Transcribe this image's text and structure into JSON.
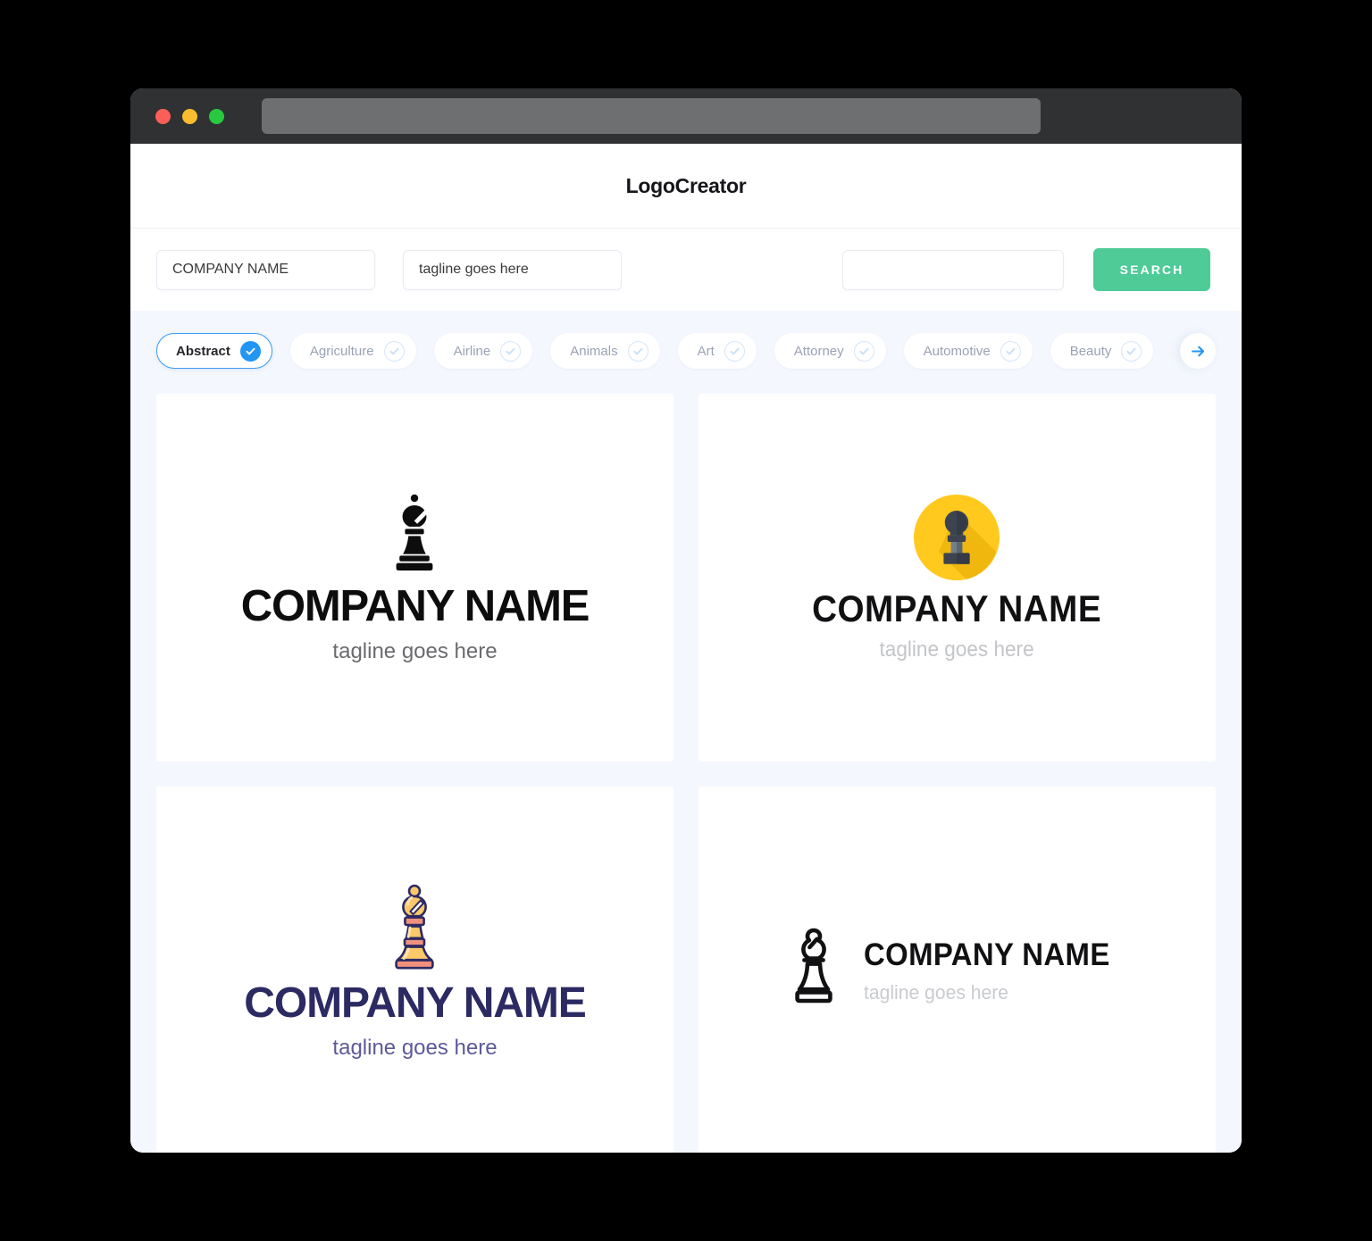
{
  "window": {
    "traffic_lights": [
      {
        "name": "close",
        "color": "#fb5f57"
      },
      {
        "name": "minimize",
        "color": "#fbbd2e"
      },
      {
        "name": "zoom",
        "color": "#28c840"
      }
    ],
    "url_value": "",
    "url_placeholder": ""
  },
  "header": {
    "title": "LogoCreator"
  },
  "search": {
    "company_value": "COMPANY NAME",
    "company_placeholder": "COMPANY NAME",
    "tagline_value": "tagline goes here",
    "tagline_placeholder": "tagline goes here",
    "keyword_value": "",
    "keyword_placeholder": "",
    "button_label": "SEARCH",
    "button_color": "#4ecb96"
  },
  "categories": {
    "items": [
      {
        "label": "Abstract",
        "selected": true
      },
      {
        "label": "Agriculture",
        "selected": false
      },
      {
        "label": "Airline",
        "selected": false
      },
      {
        "label": "Animals",
        "selected": false
      },
      {
        "label": "Art",
        "selected": false
      },
      {
        "label": "Attorney",
        "selected": false
      },
      {
        "label": "Automotive",
        "selected": false
      },
      {
        "label": "Beauty",
        "selected": false
      }
    ],
    "next_label": "→",
    "selected_color": "#2196f3"
  },
  "logos": [
    {
      "id": "logo-1",
      "mark": "chess-bishop-solid-black-icon",
      "name": "COMPANY NAME",
      "tagline": "tagline goes here",
      "name_color": "#0d0d0d",
      "tagline_color": "#6b6b6f",
      "layout": "stacked"
    },
    {
      "id": "logo-2",
      "mark": "chess-pawn-yellow-circle-icon",
      "name": "COMPANY NAME",
      "tagline": "tagline goes here",
      "name_color": "#111113",
      "tagline_color": "#c3c5c9",
      "accent_color": "#ffc91d",
      "layout": "stacked"
    },
    {
      "id": "logo-3",
      "mark": "chess-bishop-orange-icon",
      "name": "COMPANY NAME",
      "tagline": "tagline goes here",
      "name_color": "#2c2a62",
      "tagline_color": "#5d5a9a",
      "accent_color": "#fbb03b",
      "layout": "stacked"
    },
    {
      "id": "logo-4",
      "mark": "chess-bishop-outline-icon",
      "name": "COMPANY NAME",
      "tagline": "tagline goes here",
      "name_color": "#111113",
      "tagline_color": "#c9cbcf",
      "layout": "horizontal"
    }
  ]
}
